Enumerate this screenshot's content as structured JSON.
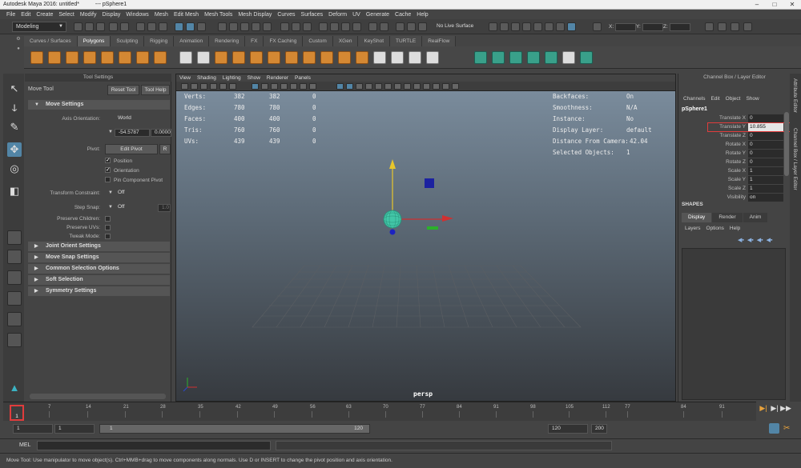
{
  "window": {
    "title": "Autodesk Maya 2016: untitled*",
    "node": "---   pSphere1",
    "controls": [
      "–",
      "□",
      "✕"
    ]
  },
  "menubar": [
    "File",
    "Edit",
    "Create",
    "Select",
    "Modify",
    "Display",
    "Windows",
    "Mesh",
    "Edit Mesh",
    "Mesh Tools",
    "Mesh Display",
    "Curves",
    "Surfaces",
    "Deform",
    "UV",
    "Generate",
    "Cache",
    "Help"
  ],
  "statusline": {
    "mode": "Modeling",
    "live_surface": "No Live Surface",
    "x_label": "X:",
    "y_label": "Y:",
    "z_label": "Z:"
  },
  "shelf": {
    "tabs": [
      "Curves / Surfaces",
      "Polygons",
      "Sculpting",
      "Rigging",
      "Animation",
      "Rendering",
      "FX",
      "FX Caching",
      "Custom",
      "XGen",
      "KeyShot",
      "TURTLE",
      "RealFlow"
    ],
    "active_tab": "Polygons"
  },
  "tool_settings": {
    "header": "Tool Settings",
    "tool_name": "Move Tool",
    "reset_button": "Reset Tool",
    "help_button": "Tool Help",
    "move_settings": "Move Settings",
    "axis_orientation_label": "Axis Orientation:",
    "axis_orientation_value": "World",
    "field_1": "-54.5787",
    "field_2": "0.0000",
    "pivot_label": "Pivot:",
    "edit_pivot": "Edit Pivot",
    "reset_short": "R",
    "position": "Position",
    "orientation": "Orientation",
    "pin_component_pivot": "Pin Component Pivot",
    "transform_constraint_label": "Transform Constraint:",
    "transform_constraint_value": "Off",
    "step_snap_label": "Step Snap:",
    "step_snap_value": "Off",
    "step_snap_number": "1.0",
    "preserve_children": "Preserve Children:",
    "preserve_uvs": "Preserve UVs:",
    "tweak_mode": "Tweak Mode:",
    "sections": [
      "Joint Orient Settings",
      "Move Snap Settings",
      "Common Selection Options",
      "Soft Selection",
      "Symmetry Settings"
    ]
  },
  "viewport": {
    "menu": [
      "View",
      "Shading",
      "Lighting",
      "Show",
      "Renderer",
      "Panels"
    ],
    "hud_left": [
      {
        "label": "Verts:",
        "a": "382",
        "b": "382",
        "c": "0"
      },
      {
        "label": "Edges:",
        "a": "780",
        "b": "780",
        "c": "0"
      },
      {
        "label": "Faces:",
        "a": "400",
        "b": "400",
        "c": "0"
      },
      {
        "label": "Tris:",
        "a": "760",
        "b": "760",
        "c": "0"
      },
      {
        "label": "UVs:",
        "a": "439",
        "b": "439",
        "c": "0"
      }
    ],
    "hud_right": [
      {
        "label": "Backfaces:",
        "value": "On"
      },
      {
        "label": "Smoothness:",
        "value": "N/A"
      },
      {
        "label": "Instance:",
        "value": "No"
      },
      {
        "label": "Display Layer:",
        "value": "default"
      },
      {
        "label": "Distance From Camera:",
        "value": "42.04"
      },
      {
        "label": "Selected Objects:",
        "value": "1"
      }
    ],
    "camera": "persp"
  },
  "channel_box": {
    "header": "Channel Box / Layer Editor",
    "menu": [
      "Channels",
      "Edit",
      "Object",
      "Show"
    ],
    "node": "pSphere1",
    "attributes": [
      {
        "name": "Translate X",
        "value": "0"
      },
      {
        "name": "Translate Y",
        "value": "10.855"
      },
      {
        "name": "Translate Z",
        "value": "0"
      },
      {
        "name": "Rotate X",
        "value": "0"
      },
      {
        "name": "Rotate Y",
        "value": "0"
      },
      {
        "name": "Rotate Z",
        "value": "0"
      },
      {
        "name": "Scale X",
        "value": "1"
      },
      {
        "name": "Scale Y",
        "value": "1"
      },
      {
        "name": "Scale Z",
        "value": "1"
      },
      {
        "name": "Visibility",
        "value": "on"
      }
    ],
    "shapes": "SHAPES",
    "tabs": [
      "Display",
      "Render",
      "Anim"
    ],
    "layer_menu": [
      "Layers",
      "Options",
      "Help"
    ],
    "side_labels": [
      "Attribute Editor",
      "Channel Box / Layer Editor"
    ]
  },
  "timeline": {
    "ticks": [
      "1",
      "7",
      "14",
      "21",
      "28",
      "35",
      "42",
      "49",
      "56",
      "63",
      "70",
      "77",
      "84",
      "91",
      "98",
      "105",
      "112",
      "77",
      "84",
      "91"
    ],
    "current_frame": "1",
    "range_start": "1",
    "range_inner_start": "1",
    "range_bar_start": "1",
    "range_bar_end": "120",
    "range_inner_end": "120",
    "range_end": "200"
  },
  "command_line": {
    "label": "MEL"
  },
  "help_line": "Move Tool: Use manipulator to move object(s). Ctrl+MMB+drag to move components along normals. Use D or INSERT to change the pivot position and axis orientation.",
  "colors": {
    "accent": "#5285a6",
    "highlight_red": "#e03c3c",
    "shelf_orange": "#d48833",
    "shelf_teal": "#39a08a"
  }
}
